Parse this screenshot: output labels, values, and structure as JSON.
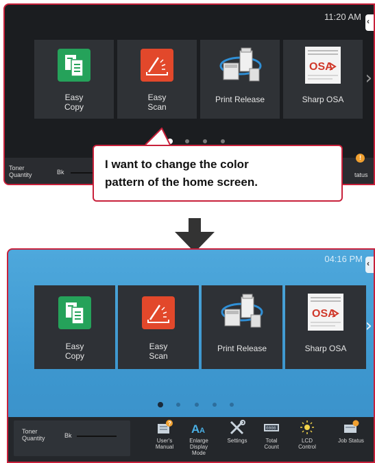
{
  "before": {
    "clock": "11:20 AM",
    "tiles": [
      {
        "label": "Easy\nCopy"
      },
      {
        "label": "Easy\nScan"
      },
      {
        "label": "Print Release"
      },
      {
        "label": "Sharp OSA"
      }
    ],
    "toner": {
      "label": "Toner\nQuantity",
      "color": "Bk"
    },
    "job_status_partial": "tatus",
    "badge_count": "!"
  },
  "callout": {
    "line1": "I want to change the color",
    "line2": "pattern of the home screen."
  },
  "after": {
    "clock": "04:16 PM",
    "tiles": [
      {
        "label": "Easy\nCopy"
      },
      {
        "label": "Easy\nScan"
      },
      {
        "label": "Print Release"
      },
      {
        "label": "Sharp OSA"
      }
    ],
    "toner": {
      "label": "Toner\nQuantity",
      "color": "Bk"
    },
    "tools": [
      {
        "label": "User's\nManual",
        "icon": "manual-icon"
      },
      {
        "label": "Enlarge\nDisplay\nMode",
        "icon": "enlarge-display-icon"
      },
      {
        "label": "Settings",
        "icon": "settings-icon"
      },
      {
        "label": "Total\nCount",
        "icon": "total-count-icon"
      },
      {
        "label": "LCD\nControl",
        "icon": "lcd-control-icon"
      },
      {
        "label": "Job Status",
        "icon": "job-status-icon"
      }
    ]
  },
  "theme": {
    "before_bg": "#1b1d20",
    "after_bg": "#4ea8dc",
    "highlight_border": "#c8203a"
  }
}
